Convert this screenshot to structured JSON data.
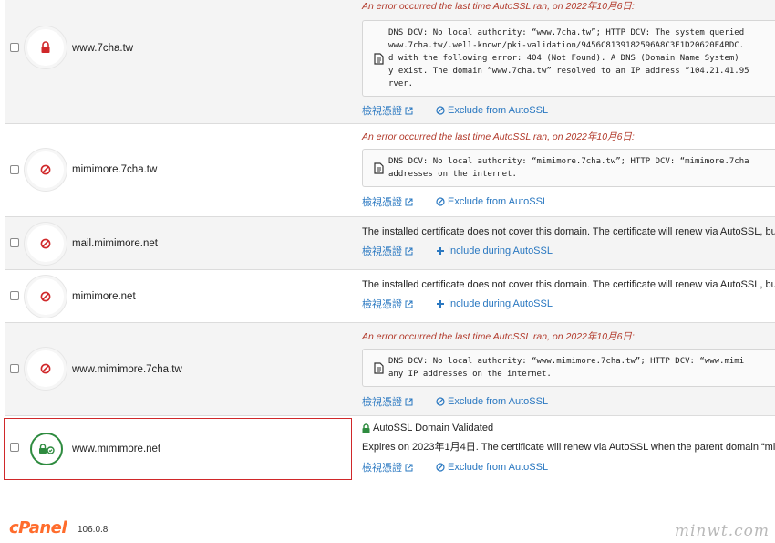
{
  "rows": [
    {
      "domain": "www.7cha.tw",
      "error_title": "An error occurred the last time AutoSSL ran, on 2022年10月6日:",
      "message": "DNS DCV: No local authority: “www.7cha.tw”; HTTP DCV: The system queried\nwww.7cha.tw/.well-known/pki-validation/9456C8139182596A8C3E1D20620E4BDC.\nd with the following error: 404 (Not Found). A DNS (Domain Name System) \ny exist. The domain “www.7cha.tw” resolved to an IP address “104.21.41.95\nrver.",
      "view_label": "檢視憑證",
      "action_label": "Exclude from AutoSSL"
    },
    {
      "domain": "mimimore.7cha.tw",
      "error_title": "An error occurred the last time AutoSSL ran, on 2022年10月6日:",
      "message": "DNS DCV: No local authority: “mimimore.7cha.tw”; HTTP DCV: “mimimore.7cha\naddresses on the internet.",
      "view_label": "檢視憑證",
      "action_label": "Exclude from AutoSSL"
    },
    {
      "domain": "mail.mimimore.net",
      "notice": "The installed certificate does not cover this domain. The certificate will renew via AutoSSL, bu",
      "view_label": "檢視憑證",
      "action_label": "Include during AutoSSL"
    },
    {
      "domain": "mimimore.net",
      "notice": "The installed certificate does not cover this domain. The certificate will renew via AutoSSL, bu",
      "view_label": "檢視憑證",
      "action_label": "Include during AutoSSL"
    },
    {
      "domain": "www.mimimore.7cha.tw",
      "error_title": "An error occurred the last time AutoSSL ran, on 2022年10月6日:",
      "message": "DNS DCV: No local authority: “www.mimimore.7cha.tw”; HTTP DCV: “www.mimi\nany IP addresses on the internet.",
      "view_label": "檢視憑證",
      "action_label": "Exclude from AutoSSL"
    },
    {
      "domain": "www.mimimore.net",
      "validated": "AutoSSL Domain Validated",
      "notice": "Expires on 2023年1月4日. The certificate will renew via AutoSSL when the parent domain “mi",
      "view_label": "檢視憑證",
      "action_label": "Exclude from AutoSSL"
    }
  ],
  "footer": {
    "logo": "cPanel",
    "version": "106.0.8"
  },
  "watermark": "minwt.com",
  "colors": {
    "error": "#b23a2b",
    "link": "#2a78c1",
    "blocked": "#d0282a",
    "valid": "#2e8b3f",
    "brand": "#ff6c2c"
  }
}
